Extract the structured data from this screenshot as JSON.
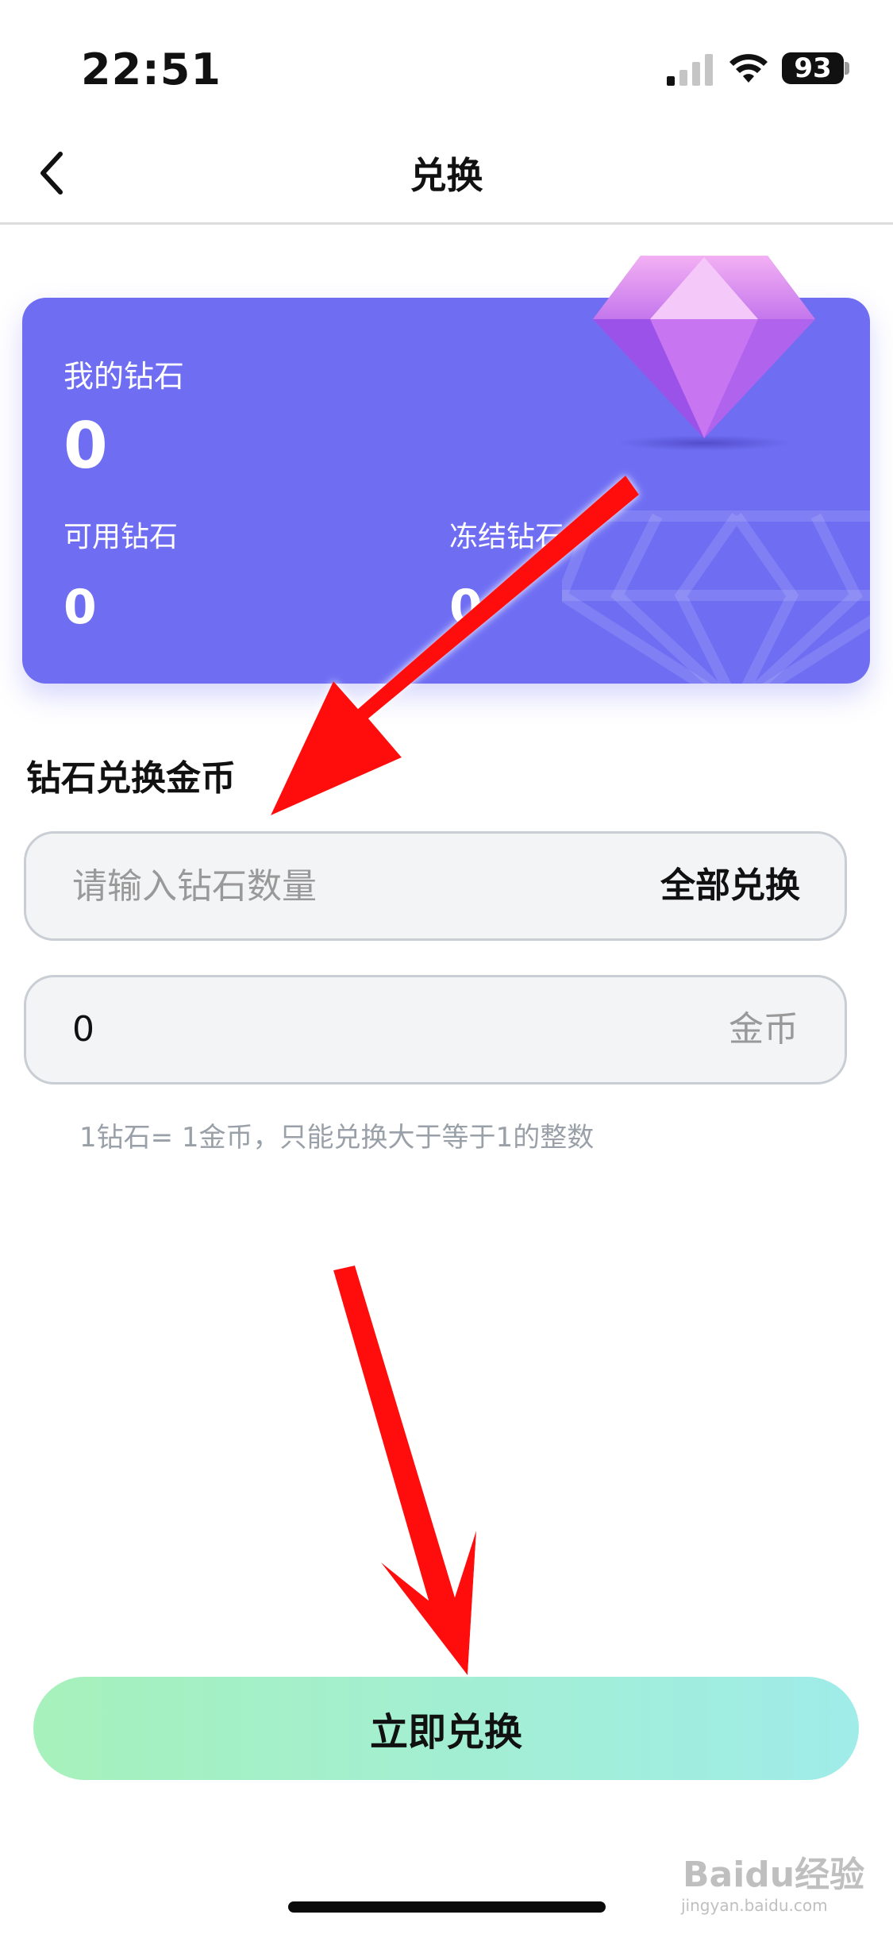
{
  "status_bar": {
    "time": "22:51",
    "battery": "93"
  },
  "header": {
    "back_icon": "chevron-left-icon",
    "title": "兑换"
  },
  "diamond_card": {
    "my_diamonds_label": "我的钻石",
    "my_diamonds_value": "0",
    "available_label": "可用钻石",
    "available_value": "0",
    "frozen_label": "冻结钻石",
    "frozen_value": "0",
    "background_color": "#6f6ef3",
    "icon": "diamond-icon"
  },
  "exchange_form": {
    "section_title": "钻石兑换金币",
    "diamond_input_placeholder": "请输入钻石数量",
    "all_exchange_label": "全部兑换",
    "coin_value": "0",
    "coin_unit": "金币",
    "hint": "1钻石= 1金币，只能兑换大于等于1的整数"
  },
  "exchange_button": {
    "label": "立即兑换",
    "gradient": [
      "#a6f1bb",
      "#9fece9"
    ]
  },
  "annotations": {
    "arrow_color": "#ff0a0a"
  },
  "watermark": {
    "text": "Baidu经验",
    "sub": "jingyan.baidu.com"
  }
}
